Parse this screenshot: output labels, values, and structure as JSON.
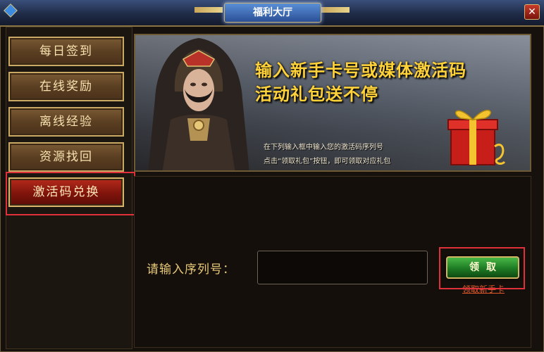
{
  "window": {
    "title": "福利大厅",
    "close_label": "✕"
  },
  "sidebar": {
    "items": [
      {
        "label": "每日签到"
      },
      {
        "label": "在线奖励"
      },
      {
        "label": "离线经验"
      },
      {
        "label": "资源找回"
      },
      {
        "label": "激活码兑换"
      }
    ],
    "active_index": 4
  },
  "banner": {
    "headline_1": "输入新手卡号或媒体激活码",
    "headline_2": "活动礼包送不停",
    "desc_1": "在下列输入框中输入您的激活码序列号",
    "desc_2": "点击“领取礼包”按钮，即可领取对应礼包"
  },
  "form": {
    "serial_label": "请输入序列号：",
    "serial_value": "",
    "claim_label": "领取",
    "newcard_link": "领取新手卡"
  },
  "colors": {
    "accent_gold": "#c9a964",
    "active_red": "#b62a1c",
    "claim_green": "#2a9a2e",
    "highlight_red": "#e0303a"
  }
}
